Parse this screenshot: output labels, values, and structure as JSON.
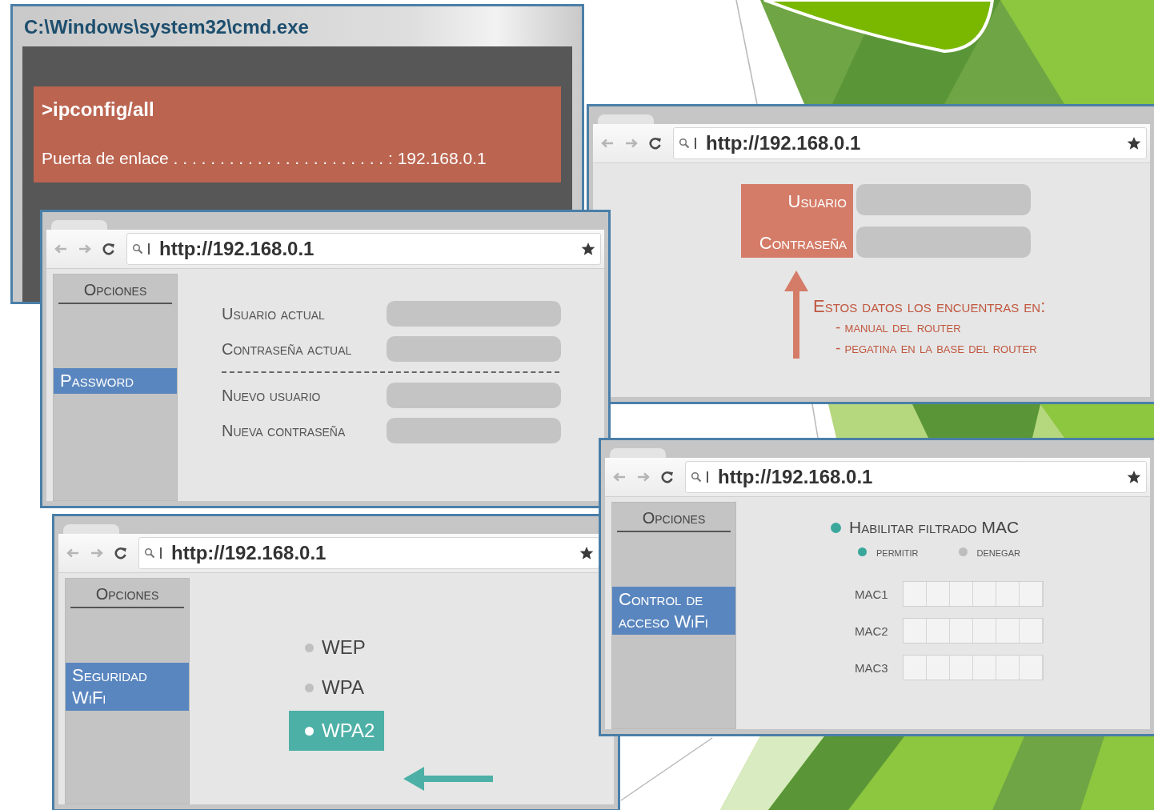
{
  "cmd_window": {
    "title": "C:\\Windows\\system32\\cmd.exe",
    "command": ">ipconfig/all",
    "output": "Puerta de enlace . . . . . . . . . . . . . . . . . . . . . . . : 192.168.0.1"
  },
  "browser_windows": [
    {
      "kind": "login",
      "url": "http://192.168.0.1",
      "fields": [
        "Usuario",
        "Contraseña"
      ],
      "note": {
        "title": "Estos datos los encuentras en:",
        "items": [
          "- manual del router",
          "- pegatina en la base del router"
        ]
      }
    },
    {
      "kind": "password",
      "url": "http://192.168.0.1",
      "sidebar": {
        "heading": "Opciones",
        "items": [
          {
            "label": "Password",
            "selected": true
          }
        ]
      },
      "field_groups": [
        [
          "Usuario actual",
          "Contraseña actual"
        ],
        [
          "Nuevo usuario",
          "Nueva contraseña"
        ]
      ]
    },
    {
      "kind": "security",
      "url": "http://192.168.0.1",
      "sidebar": {
        "heading": "Opciones",
        "items": [
          {
            "label": "Seguridad WiFi",
            "selected": true
          }
        ]
      },
      "options": [
        {
          "label": "WEP",
          "selected": false
        },
        {
          "label": "WPA",
          "selected": false
        },
        {
          "label": "WPA2",
          "selected": true
        }
      ]
    },
    {
      "kind": "mac",
      "url": "http://192.168.0.1",
      "sidebar": {
        "heading": "Opciones",
        "items": [
          {
            "label": "Control de acceso WiFi",
            "selected": true
          }
        ]
      },
      "filter": {
        "label": "Habilitar filtrado MAC",
        "checked": true
      },
      "modes": [
        {
          "label": "permitir",
          "selected": true
        },
        {
          "label": "denegar",
          "selected": false
        }
      ],
      "mac_rows": [
        "MAC1",
        "MAC2",
        "MAC3"
      ]
    }
  ]
}
